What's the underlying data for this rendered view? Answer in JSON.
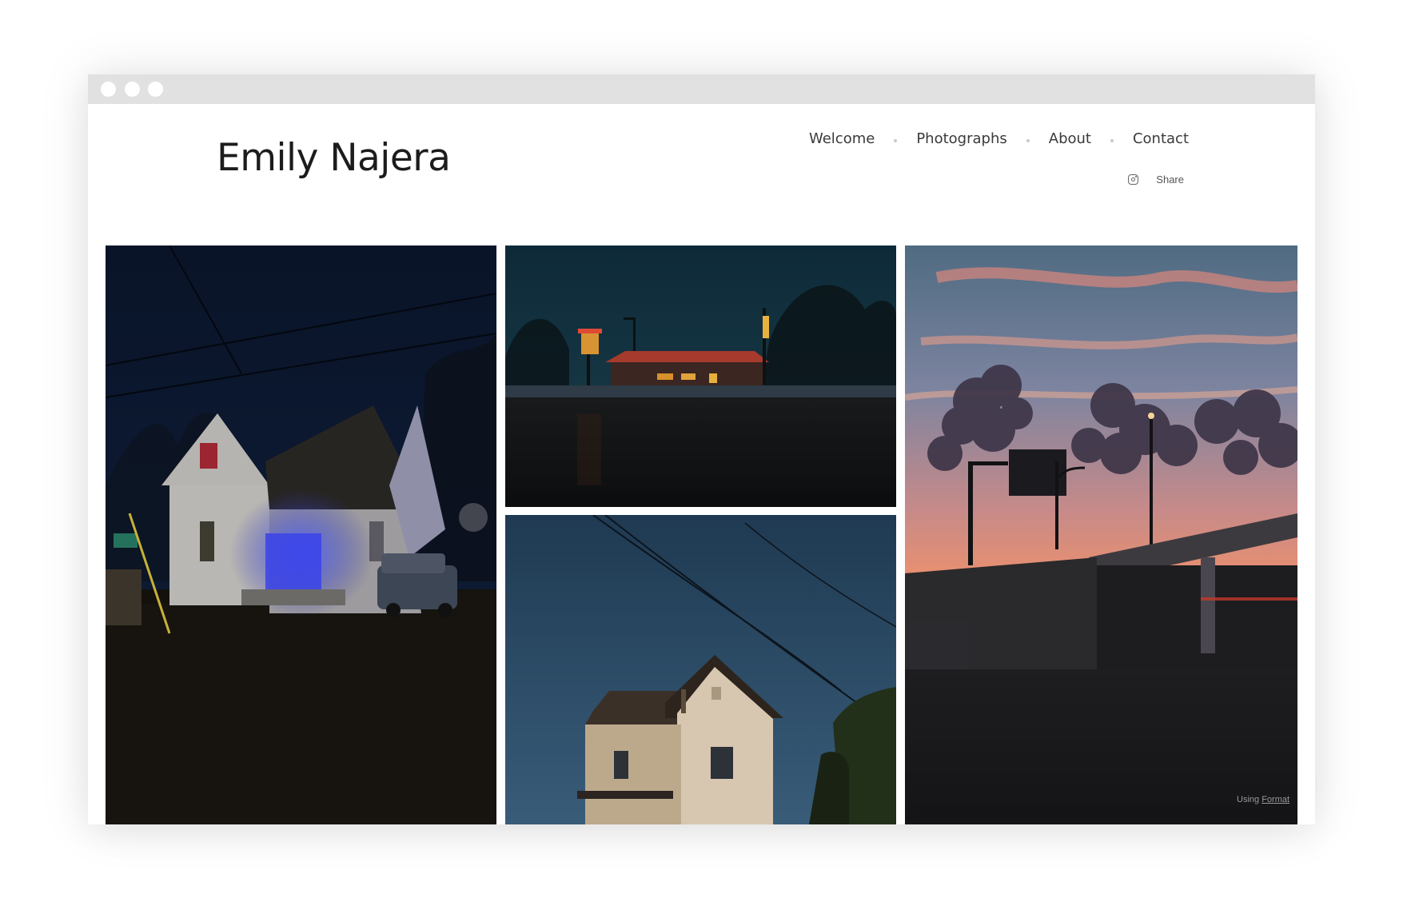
{
  "site": {
    "title": "Emily Najera"
  },
  "nav": {
    "items": [
      {
        "label": "Welcome"
      },
      {
        "label": "Photographs"
      },
      {
        "label": "About"
      },
      {
        "label": "Contact"
      }
    ]
  },
  "social": {
    "instagram_icon": "instagram-icon",
    "share_label": "Share"
  },
  "gallery": {
    "photos": [
      {
        "subject": "house with blue porch lights at night"
      },
      {
        "subject": "roadside diner with lit sign at dusk"
      },
      {
        "subject": "white house in sunlight against blue sky"
      },
      {
        "subject": "highway overpass and sign at sunset"
      }
    ]
  },
  "footer": {
    "using_prefix": "Using",
    "using_link": "Format"
  },
  "colors": {
    "titlebar": "#e1e1e1",
    "title_text": "#1c1c1c",
    "nav_text": "#3a3a3a"
  }
}
